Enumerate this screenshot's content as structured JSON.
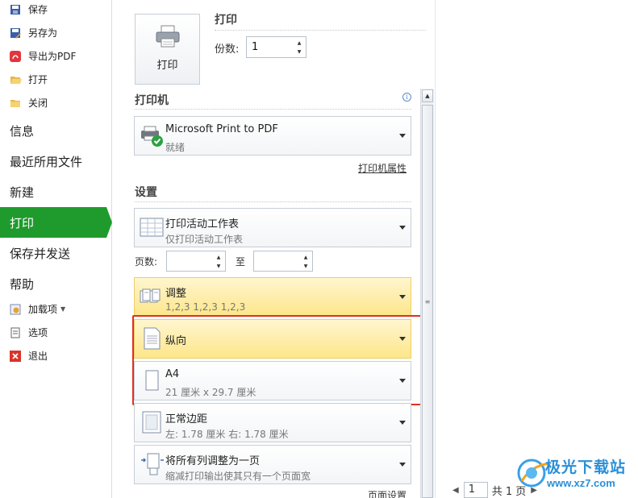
{
  "nav": {
    "small_top": [
      {
        "label": "保存",
        "icon": "save-icon"
      },
      {
        "label": "另存为",
        "icon": "save-as-icon"
      },
      {
        "label": "导出为PDF",
        "icon": "pdf-icon"
      },
      {
        "label": "打开",
        "icon": "folder-open-icon"
      },
      {
        "label": "关闭",
        "icon": "folder-close-icon"
      }
    ],
    "big": [
      {
        "label": "信息"
      },
      {
        "label": "最近所用文件"
      },
      {
        "label": "新建"
      },
      {
        "label": "打印"
      },
      {
        "label": "保存并发送"
      },
      {
        "label": "帮助"
      }
    ],
    "small_bottom": [
      {
        "label": "加载项",
        "icon": "addins-icon"
      },
      {
        "label": "选项",
        "icon": "options-icon"
      },
      {
        "label": "退出",
        "icon": "exit-icon"
      }
    ],
    "accent_color": "#1f9b2d"
  },
  "print": {
    "section_title": "打印",
    "button_label": "打印",
    "copies_label": "份数:",
    "copies_value": "1"
  },
  "printer": {
    "section_title": "打印机",
    "name": "Microsoft Print to PDF",
    "status": "就绪",
    "properties_link": "打印机属性"
  },
  "settings": {
    "section_title": "设置",
    "what": {
      "title": "打印活动工作表",
      "subtitle": "仅打印活动工作表"
    },
    "pages_label": "页数:",
    "to_label": "至",
    "collate": {
      "title": "调整",
      "subtitle": "1,2,3    1,2,3    1,2,3"
    },
    "orientation": {
      "title": "纵向"
    },
    "paper": {
      "title": "A4",
      "subtitle": "21 厘米 x 29.7 厘米"
    },
    "margins": {
      "title": "正常边距",
      "subtitle": "左: 1.78 厘米    右: 1.78 厘米"
    },
    "scaling": {
      "title": "将所有列调整为一页",
      "subtitle": "缩减打印输出使其只有一个页面宽"
    },
    "page_setup_link": "页面设置"
  },
  "preview": {
    "page_value": "1",
    "page_total": "共 1 页"
  },
  "watermark": {
    "text": "极光下载站",
    "url": "www.xz7.com"
  },
  "highlight_color": "#e0301e"
}
